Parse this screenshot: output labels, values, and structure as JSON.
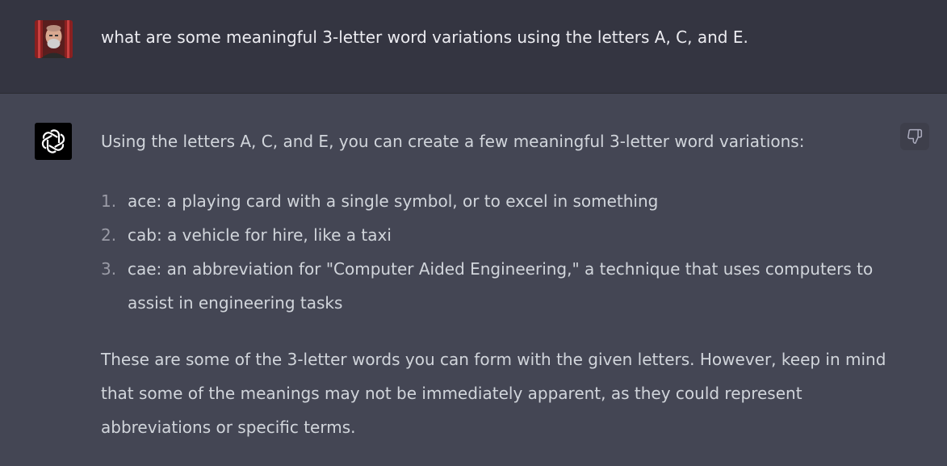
{
  "user_message": {
    "avatar_icon": "user-photo-avatar",
    "text": "what are some meaningful 3-letter word variations using the letters A, C, and E."
  },
  "assistant_message": {
    "avatar_icon": "openai-logo-icon",
    "intro": "Using the letters A, C, and E, you can create a few meaningful 3-letter word variations:",
    "items": [
      {
        "number": "1.",
        "text": "ace: a playing card with a single symbol, or to excel in something"
      },
      {
        "number": "2.",
        "text": "cab: a vehicle for hire, like a taxi"
      },
      {
        "number": "3.",
        "text": "cae: an abbreviation for \"Computer Aided Engineering,\" a technique that uses computers to assist in engineering tasks"
      }
    ],
    "outro": "These are some of the 3-letter words you can form with the given letters. However, keep in mind that some of the meanings may not be immediately apparent, as they could represent abbreviations or specific terms.",
    "feedback_icon": "thumbs-down-icon"
  },
  "colors": {
    "user_bg": "#343541",
    "assistant_bg": "#444654",
    "text": "#d1d5db"
  }
}
